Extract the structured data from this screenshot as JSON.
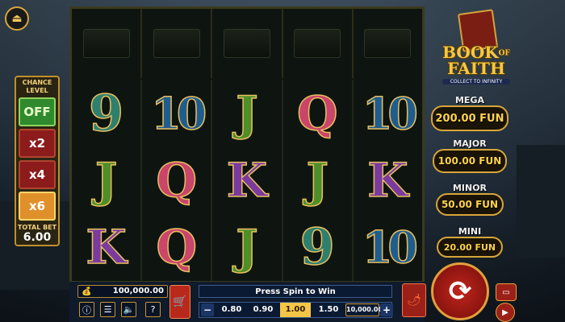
{
  "game": {
    "logo": {
      "title_line1": "BOOK",
      "title_of": "OF",
      "title_line2": "FAITH",
      "subtitle": "COLLECT TO INFINITY"
    },
    "reels": [
      [
        "9",
        "J",
        "K"
      ],
      [
        "10",
        "Q",
        "Q"
      ],
      [
        "J",
        "K",
        "J"
      ],
      [
        "Q",
        "J",
        "9"
      ],
      [
        "10",
        "K",
        "10"
      ]
    ],
    "chance_level": {
      "title": "CHANCE LEVEL",
      "options": [
        "OFF",
        "x2",
        "x4",
        "x6"
      ],
      "selected": "x6"
    },
    "total_bet": {
      "label": "TOTAL BET",
      "value": "6.00"
    },
    "jackpots": [
      {
        "name": "MEGA",
        "value": "200.00 FUN"
      },
      {
        "name": "MAJOR",
        "value": "100.00 FUN"
      },
      {
        "name": "MINOR",
        "value": "50.00 FUN"
      },
      {
        "name": "MINI",
        "value": "20.00 FUN"
      }
    ],
    "balance": "100,000.00",
    "message": "Press Spin to Win",
    "stakes": [
      "0.80",
      "0.90",
      "1.00",
      "1.50"
    ],
    "selected_stake": "1.00",
    "max_bet": "10,000.00",
    "minus_label": "−",
    "plus_label": "+",
    "icons": {
      "exit": "exit-icon",
      "info": "info-icon",
      "menu": "menu-icon",
      "sound": "sound-icon",
      "help": "help-icon",
      "cart": "cart-icon",
      "turbo": "turbo-icon",
      "spin": "spin-icon",
      "autoplay": "autoplay-icon",
      "card": "card-icon"
    },
    "icon_glyphs": {
      "info": "ⓘ",
      "menu": "☰",
      "sound": "🔈",
      "help": "?",
      "cart": "🛒",
      "turbo": "🌶",
      "spin": "⟳",
      "autoplay": "▶",
      "card": "▭",
      "exit": "⏏",
      "bag": "💰"
    }
  }
}
